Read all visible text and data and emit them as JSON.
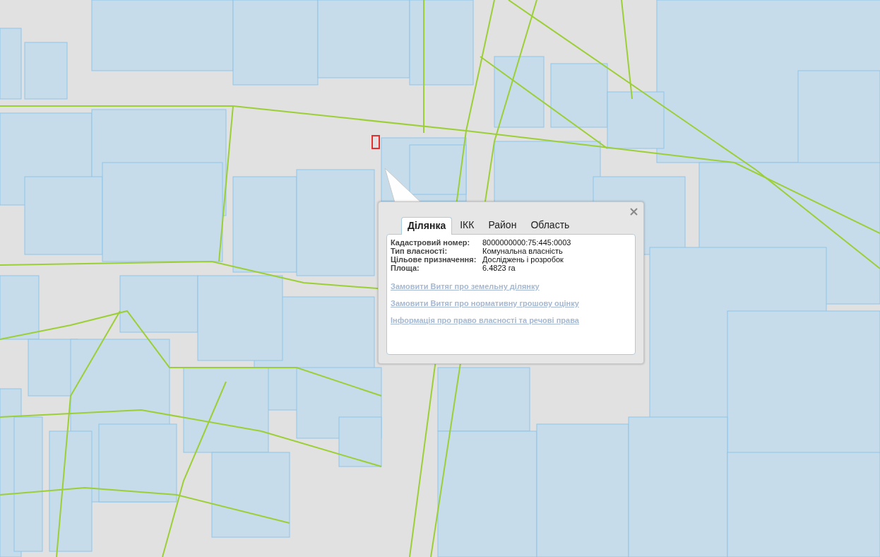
{
  "popup": {
    "tabs": [
      {
        "label": "Ділянка",
        "selected": true
      },
      {
        "label": "ІКК",
        "selected": false
      },
      {
        "label": "Район",
        "selected": false
      },
      {
        "label": "Область",
        "selected": false
      }
    ],
    "fields": [
      {
        "label": "Кадастровий номер:",
        "value": "8000000000:75:445:0003"
      },
      {
        "label": "Тип власності:",
        "value": "Комунальна власність"
      },
      {
        "label": "Цільове призначення:",
        "value": "Досліджень і розробок"
      },
      {
        "label": "Площа:",
        "value": "6.4823 га"
      }
    ],
    "links": [
      "Замовити Витяг про земельну ділянку",
      "Замовити Витяг про нормативну грошову оцінку",
      "Інформація про право власності та речові права"
    ]
  }
}
